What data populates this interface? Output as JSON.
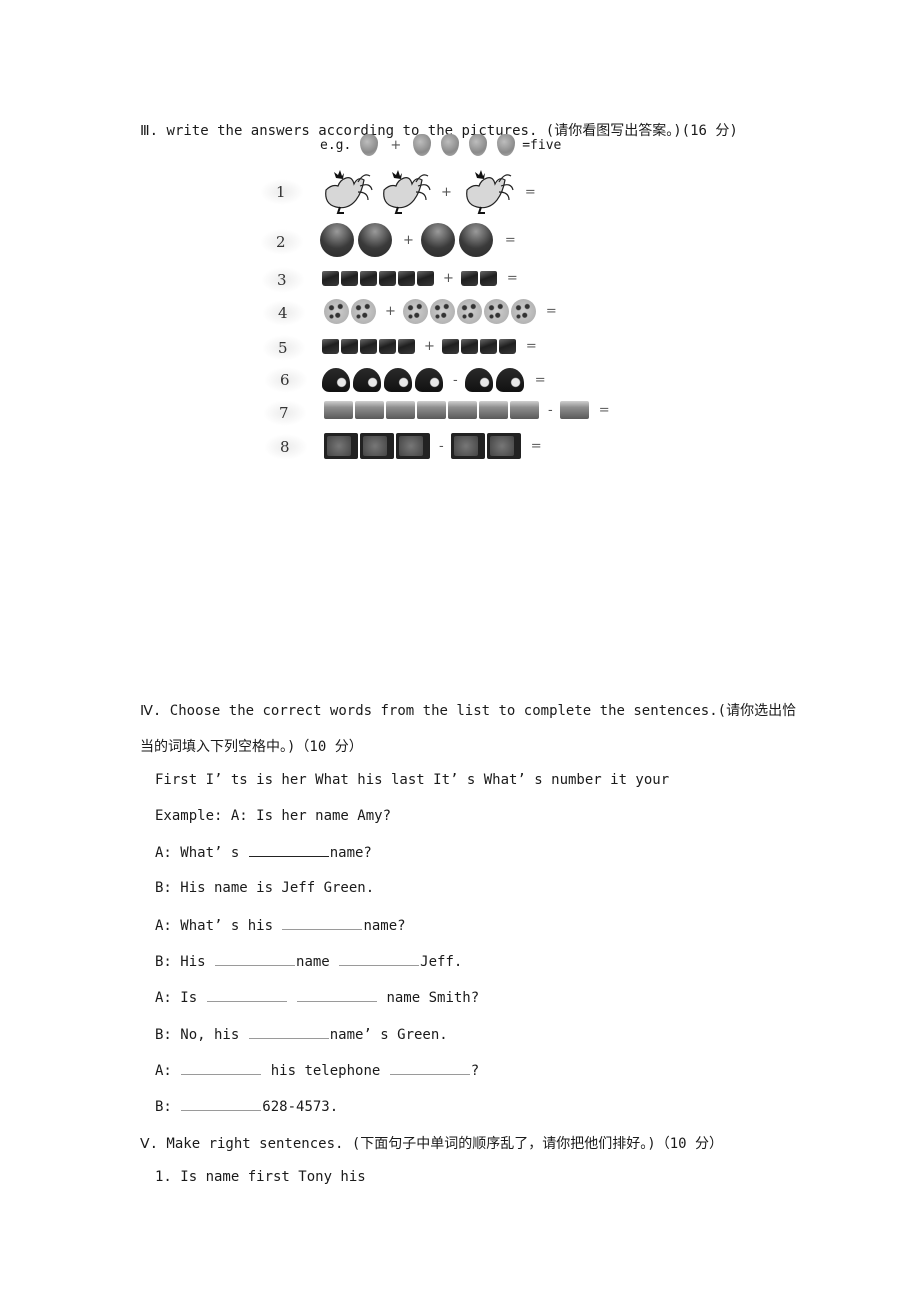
{
  "section3": {
    "heading": "Ⅲ. write the answers according to the pictures. (请你看图写出答案。)(16 分)",
    "example": {
      "label": "e.g.",
      "left_icon": "strawberry-icon",
      "left_count": 1,
      "operator": "+",
      "right_count": 4,
      "result": "=five"
    },
    "problems": [
      {
        "number": "1",
        "icon": "hen-icon",
        "left_count": 2,
        "operator": "+",
        "right_count": 1,
        "equals": "="
      },
      {
        "number": "2",
        "icon": "basketball-icon",
        "left_count": 2,
        "operator": "+",
        "right_count": 2,
        "equals": "="
      },
      {
        "number": "3",
        "icon": "gift-box-icon",
        "left_count": 6,
        "operator": "+",
        "right_count": 2,
        "equals": "="
      },
      {
        "number": "4",
        "icon": "cookie-icon",
        "left_count": 2,
        "operator": "+",
        "right_count": 5,
        "equals": "="
      },
      {
        "number": "5",
        "icon": "gift-box-icon",
        "left_count": 5,
        "operator": "+",
        "right_count": 4,
        "equals": "="
      },
      {
        "number": "6",
        "icon": "helmet-icon",
        "left_count": 4,
        "operator": "-",
        "right_count": 2,
        "equals": "="
      },
      {
        "number": "7",
        "icon": "basket-icon",
        "left_count": 7,
        "operator": "-",
        "right_count": 1,
        "equals": "="
      },
      {
        "number": "8",
        "icon": "tv-icon",
        "left_count": 3,
        "operator": "-",
        "right_count": 2,
        "equals": "="
      }
    ]
  },
  "section4": {
    "heading_line1": "Ⅳ. Choose the correct words from the list to complete the sentences.(请你选出恰",
    "heading_line2": "当的词填入下列空格中。)（10 分）",
    "word_list": "First I’  ts is her What his last It’ s What’ s number it your",
    "example": "Example: A: Is her name Amy?",
    "dialogue": [
      {
        "parts": [
          "A: What’ s ",
          "__BLANK_DARK__",
          "name?"
        ]
      },
      {
        "parts": [
          "B: His name is Jeff Green."
        ]
      },
      {
        "parts": [
          "A: What’ s his ",
          "__BLANK__",
          "name?"
        ]
      },
      {
        "parts": [
          "B: His ",
          "__BLANK__",
          "name ",
          "__BLANK__",
          "Jeff."
        ]
      },
      {
        "parts": [
          "A: Is ",
          "__BLANK__",
          " ",
          "__BLANK__",
          " name Smith?"
        ]
      },
      {
        "parts": [
          "B: No, his ",
          "__BLANK__",
          "name’ s Green."
        ]
      },
      {
        "parts": [
          "A: ",
          "__BLANK__",
          " his telephone ",
          "__BLANK__",
          "?"
        ]
      },
      {
        "parts": [
          "B: ",
          "__BLANK__",
          "628-4573."
        ]
      }
    ]
  },
  "section5": {
    "heading": "Ⅴ. Make right sentences. (下面句子中单词的顺序乱了，请你把他们排好。)（10 分）",
    "items": [
      "1. Is name first Tony his"
    ]
  }
}
